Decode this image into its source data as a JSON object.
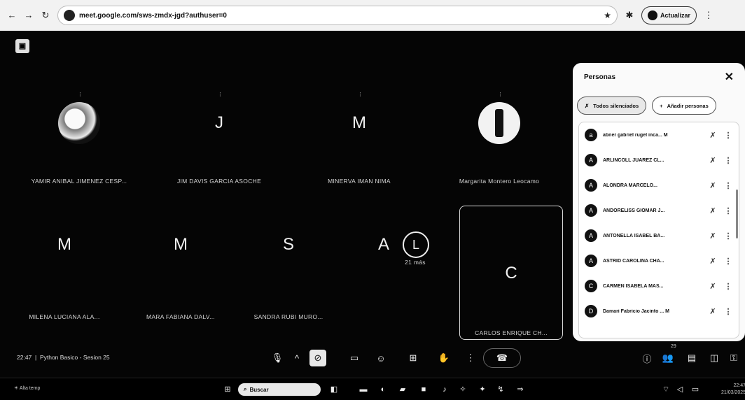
{
  "browser": {
    "url": "meet.google.com/sws-zmdx-jgd?authuser=0",
    "profile_label": "Actualizar"
  },
  "meet": {
    "app_logo": "meet-logo",
    "tiles_row1": [
      {
        "name": "YAMIR ANIBAL JIMENEZ CESP...",
        "initial": "",
        "avatar": "globe-photo"
      },
      {
        "name": "JIM DAVIS GARCIA ASOCHE",
        "initial": "J",
        "avatar": "letter"
      },
      {
        "name": "MINERVA IMAN NIMA",
        "initial": "M",
        "avatar": "letter"
      },
      {
        "name": "Margarita Montero Leocamo",
        "initial": "",
        "avatar": "phone-photo"
      }
    ],
    "tiles_row2": [
      {
        "name": "MILENA LUCIANA ALA...",
        "initial": "M"
      },
      {
        "name": "MARA FABIANA DALV...",
        "initial": "M"
      },
      {
        "name": "SANDRA RUBI MURO...",
        "initial": "S"
      },
      {
        "name": "21 más",
        "initial": "A",
        "initial2": "L"
      },
      {
        "name": "CARLOS ENRIQUE CH...",
        "initial": "C"
      }
    ]
  },
  "panel": {
    "title": "Personas",
    "mute_all_label": "Todos silenciados",
    "add_people_label": "Añadir personas",
    "people": [
      {
        "initial": "a",
        "name": "abner gabriel rugel inca... M"
      },
      {
        "initial": "A",
        "name": "ARLINCOLL JUAREZ CL..."
      },
      {
        "initial": "A",
        "name": "ALONDRA MARCELO..."
      },
      {
        "initial": "A",
        "name": "ANDORELISS GIOMAR J..."
      },
      {
        "initial": "A",
        "name": "ANTONELLA ISABEL BA..."
      },
      {
        "initial": "A",
        "name": "ASTRID CAROLINA CHA..."
      },
      {
        "initial": "C",
        "name": "CARMEN ISABELA MAS..."
      },
      {
        "initial": "D",
        "name": "Damari Fabricio Jacinto ... M"
      }
    ]
  },
  "controls": {
    "time": "22:47",
    "meeting_title": "Python Basico - Sesion 25",
    "people_count": "29"
  },
  "taskbar": {
    "weather": "Alta temp",
    "search_label": "Buscar",
    "clock_time": "22:47",
    "clock_date": "21/03/2025"
  }
}
